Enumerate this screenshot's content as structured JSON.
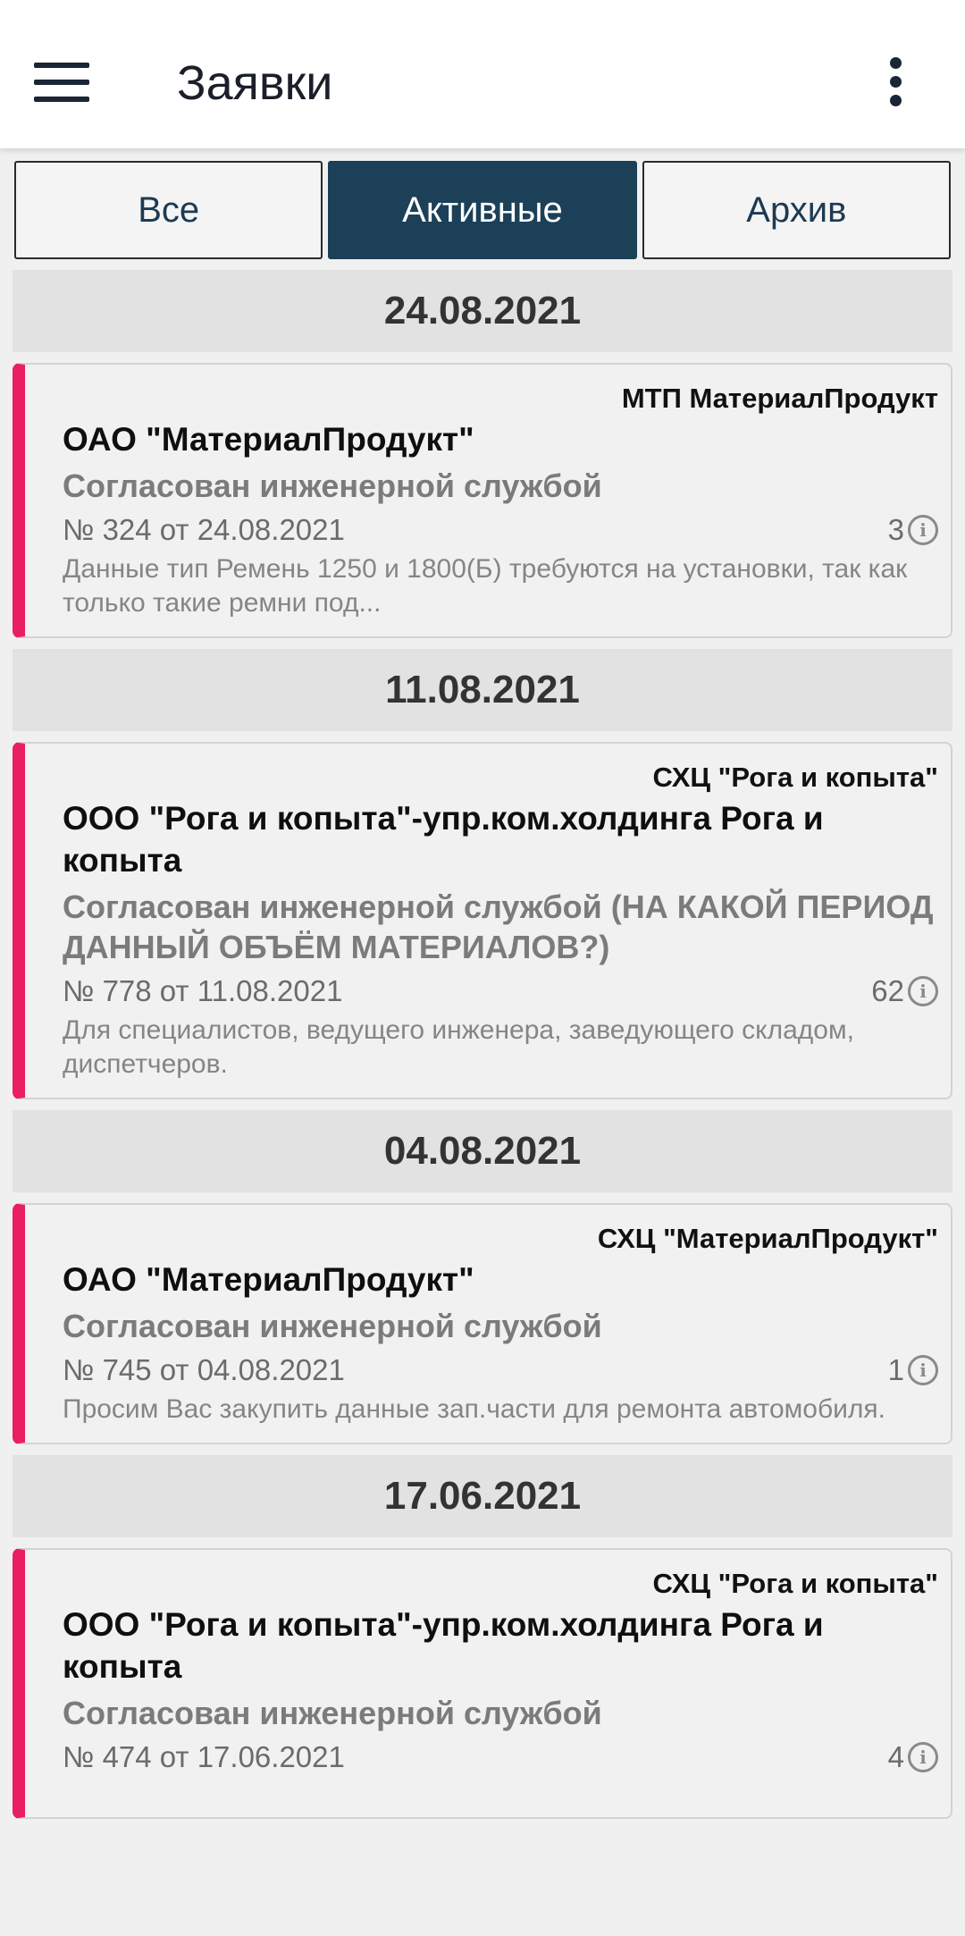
{
  "app": {
    "title": "Заявки"
  },
  "tabs": [
    {
      "label": "Все",
      "active": false
    },
    {
      "label": "Активные",
      "active": true
    },
    {
      "label": "Архив",
      "active": false
    }
  ],
  "colors": {
    "accent": "#1b4058",
    "stripe": "#e91e63"
  },
  "groups": [
    {
      "date": "24.08.2021",
      "card": {
        "org": "МТП МатериалПродукт",
        "title": "ОАО \"МатериалПродукт\"",
        "status": "Согласован инженерной службой",
        "number": "№ 324 от 24.08.2021",
        "count": "3",
        "description": "Данные тип Ремень 1250 и 1800(Б) требуются на установки, так как только такие ремни под..."
      }
    },
    {
      "date": "11.08.2021",
      "card": {
        "org": "СХЦ \"Рога и копыта\"",
        "title": "ООО \"Рога и копыта\"-упр.ком.холдинга Рога и копыта",
        "status": "Согласован инженерной службой (НА КАКОЙ ПЕРИОД ДАННЫЙ ОБЪЁМ МАТЕРИАЛОВ?)",
        "number": "№ 778 от 11.08.2021",
        "count": "62",
        "description": "Для специалистов, ведущего инженера, заведующего складом, диспетчеров."
      }
    },
    {
      "date": "04.08.2021",
      "card": {
        "org": "СХЦ \"МатериалПродукт\"",
        "title": "ОАО \"МатериалПродукт\"",
        "status": "Согласован инженерной службой",
        "number": "№ 745 от 04.08.2021",
        "count": "1",
        "description": "Просим Вас закупить данные зап.части для ремонта автомобиля."
      }
    },
    {
      "date": "17.06.2021",
      "card": {
        "org": "СХЦ \"Рога и копыта\"",
        "title": "ООО \"Рога и копыта\"-упр.ком.холдинга Рога и копыта",
        "status": "Согласован инженерной службой",
        "number": "№ 474 от 17.06.2021",
        "count": "4",
        "description": ""
      }
    }
  ]
}
